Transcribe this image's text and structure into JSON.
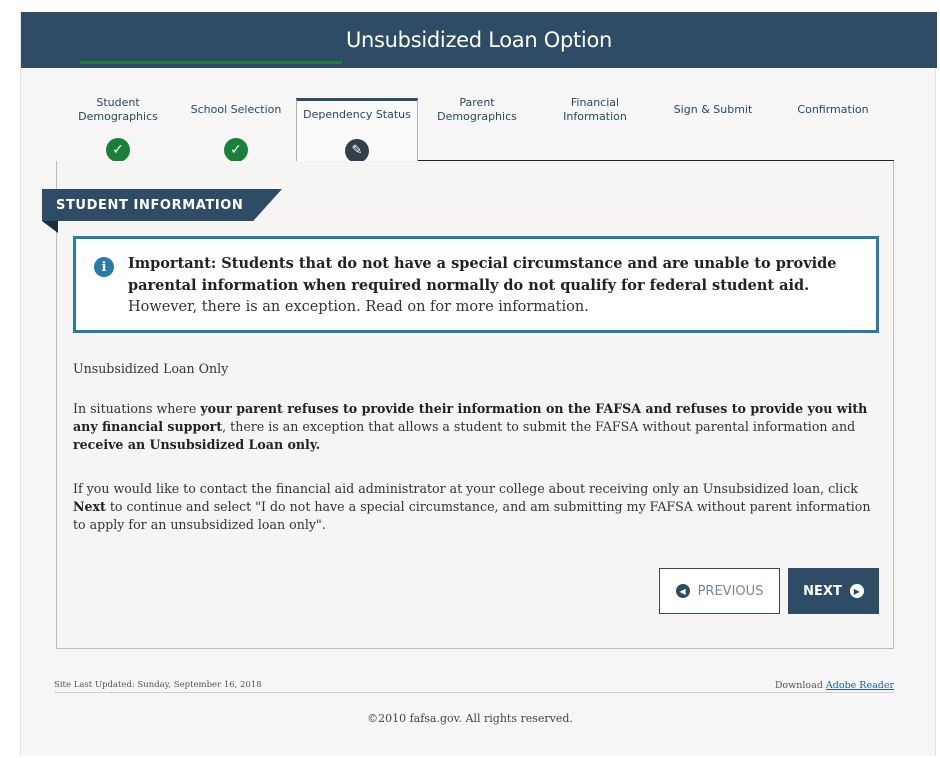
{
  "header": {
    "title": "Unsubsidized Loan Option"
  },
  "steps": [
    {
      "label_line1": "Student",
      "label_line2": "Demographics",
      "status": "done"
    },
    {
      "label_line1": "School Selection",
      "label_line2": "",
      "status": "done"
    },
    {
      "label_line1": "Dependency Status",
      "label_line2": "",
      "status": "current"
    },
    {
      "label_line1": "Parent",
      "label_line2": "Demographics",
      "status": "upcoming"
    },
    {
      "label_line1": "Financial",
      "label_line2": "Information",
      "status": "upcoming"
    },
    {
      "label_line1": "Sign & Submit",
      "label_line2": "",
      "status": "upcoming"
    },
    {
      "label_line1": "Confirmation",
      "label_line2": "",
      "status": "upcoming"
    }
  ],
  "section": {
    "title": "STUDENT INFORMATION"
  },
  "notice": {
    "bold": "Important: Students that do not have a special circumstance and are unable to provide parental information when required normally do not qualify for federal student aid.",
    "normal": " However, there is an exception. Read on for more information."
  },
  "content": {
    "subtitle": "Unsubsidized Loan Only",
    "p1_a": "In situations where ",
    "p1_b": "your parent refuses to provide their information on the FAFSA and refuses to provide you with any financial support",
    "p1_c": ", there is an exception that allows a student to submit the FAFSA without parental information and ",
    "p1_d": "receive an Unsubsidized Loan only.",
    "p2_a": "If you would like to contact the financial aid administrator at your college about receiving only an Unsubsidized loan, click ",
    "p2_b": "Next",
    "p2_c": " to continue and select \"I do not have a special circumstance, and am submitting my FAFSA without parent information to apply for an unsubsidized loan only\"."
  },
  "buttons": {
    "previous": "PREVIOUS",
    "next": "NEXT"
  },
  "footer": {
    "last_updated": "Site Last Updated: Sunday, September 16, 2018",
    "download_prefix": "Download ",
    "download_link": "Adobe Reader",
    "copyright": "©2010 fafsa.gov. All rights reserved."
  },
  "colors": {
    "header": "#2f4c66",
    "done": "#1a7f3a",
    "notice_border": "#2a7aa9"
  }
}
